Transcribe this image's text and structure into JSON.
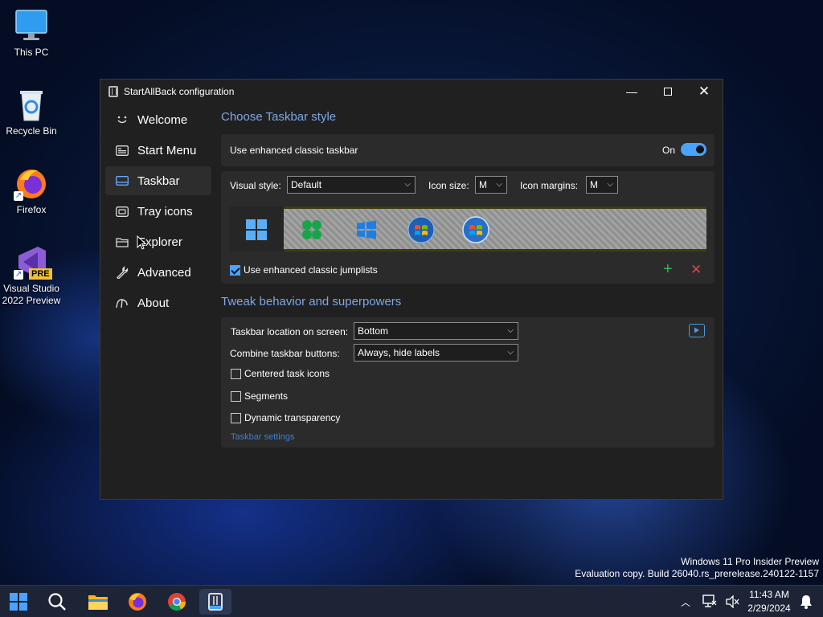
{
  "desktop": {
    "icons": [
      {
        "label": "This PC"
      },
      {
        "label": "Recycle Bin"
      },
      {
        "label": "Firefox"
      },
      {
        "label": "Visual Studio\n2022 Preview",
        "line1": "Visual Studio",
        "line2": "2022 Preview",
        "badge": "PRE"
      }
    ],
    "watermark": {
      "line1": "Windows 11 Pro Insider Preview",
      "line2": "Evaluation copy. Build 26040.rs_prerelease.240122-1157"
    }
  },
  "window": {
    "title": "StartAllBack configuration",
    "nav": [
      {
        "label": "Welcome",
        "icon": "smiley-icon"
      },
      {
        "label": "Start Menu",
        "icon": "start-menu-icon"
      },
      {
        "label": "Taskbar",
        "icon": "taskbar-icon",
        "active": true
      },
      {
        "label": "Tray icons",
        "icon": "tray-icon"
      },
      {
        "label": "Explorer",
        "icon": "folder-icon"
      },
      {
        "label": "Advanced",
        "icon": "wrench-icon"
      },
      {
        "label": "About",
        "icon": "info-icon"
      }
    ],
    "section1": {
      "title": "Choose Taskbar style",
      "enhanced_label": "Use enhanced classic taskbar",
      "toggle_state": "On",
      "visual_style_label": "Visual style:",
      "visual_style_value": "Default",
      "icon_size_label": "Icon size:",
      "icon_size_value": "M",
      "icon_margins_label": "Icon margins:",
      "icon_margins_value": "M",
      "jumplists_label": "Use enhanced classic jumplists",
      "jumplists_checked": true
    },
    "section2": {
      "title": "Tweak behavior and superpowers",
      "location_label": "Taskbar location on screen:",
      "location_value": "Bottom",
      "combine_label": "Combine taskbar buttons:",
      "combine_value": "Always, hide labels",
      "centered_label": "Centered task icons",
      "segments_label": "Segments",
      "dynamic_label": "Dynamic transparency",
      "settings_link": "Taskbar settings"
    }
  },
  "taskbar": {
    "time": "11:43 AM",
    "date": "2/29/2024"
  },
  "colors": {
    "accent": "#4aa3ff",
    "section_title": "#7ea7e8",
    "window_bg": "#202020",
    "card_bg": "#2b2b2b"
  }
}
